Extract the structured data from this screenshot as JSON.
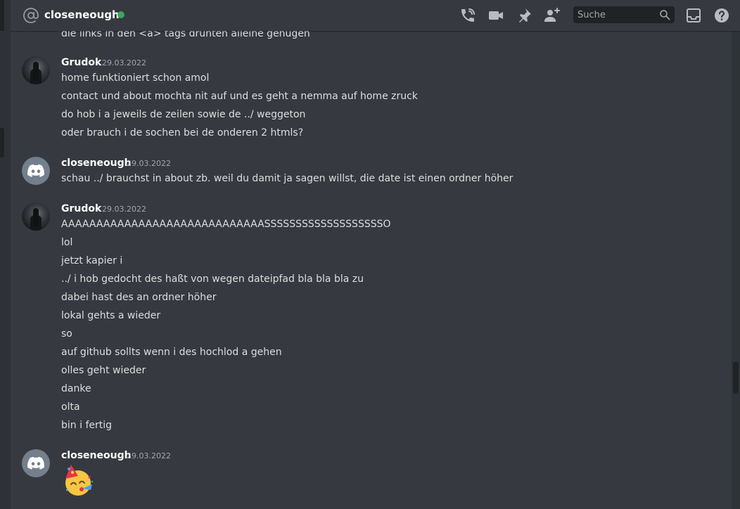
{
  "header": {
    "title": "closeneough",
    "search_placeholder": "Suche"
  },
  "colors": {
    "online": "#3ba55d",
    "background": "#36393f",
    "text": "#dcddde",
    "author": "#ffffff",
    "timestamp": "#a3a6aa"
  },
  "icons": [
    "at-icon",
    "voice-call-icon",
    "video-call-icon",
    "pin-icon",
    "add-friend-icon",
    "search-icon",
    "inbox-icon",
    "help-icon"
  ],
  "cutoff_message": "die links in den <a> tags drunten alleine genügen",
  "messages": [
    {
      "author": "Grudok",
      "timestamp": "29.03.2022",
      "lines": [
        "home funktioniert schon amol",
        "contact und about mochta nit auf und es geht a nemma auf home zruck",
        "do hob i a jeweils de zeilen sowie de ../ weggeton",
        "oder brauch i de sochen bei de onderen 2 htmls?"
      ]
    },
    {
      "author": "closeneough",
      "timestamp": "29.03.2022",
      "lines": [
        "schau ../ brauchst in about zb. weil du damit ja sagen willst, die date ist einen ordner höher"
      ]
    },
    {
      "author": "Grudok",
      "timestamp": "29.03.2022",
      "lines": [
        "AAAAAAAAAAAAAAAAAAAAAAAAAAAAASSSSSSSSSSSSSSSSSSSO",
        "lol",
        "jetzt kapier i",
        "../ i hob gedocht des haßt von wegen dateipfad bla bla bla zu",
        "dabei hast des an ordner höher",
        "lokal gehts a wieder",
        "so",
        "auf github sollts wenn i des hochlod a gehen",
        "olles geht wieder",
        "danke",
        "olta",
        "bin i fertig"
      ]
    },
    {
      "author": "closeneough",
      "timestamp": "29.03.2022",
      "emoji": "partying-face-emoji"
    }
  ]
}
